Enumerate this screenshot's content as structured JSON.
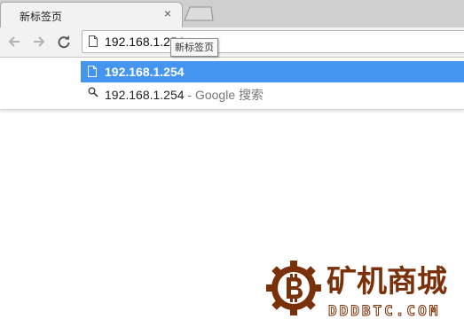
{
  "tab": {
    "title": "新标签页",
    "close_icon": "close-icon"
  },
  "toolbar": {
    "back_icon": "arrow-left-icon",
    "forward_icon": "arrow-right-icon",
    "reload_icon": "reload-icon"
  },
  "omnibox": {
    "value": "192.168.1.254",
    "page_icon": "page-icon",
    "tooltip": "新标签页"
  },
  "suggestions": [
    {
      "icon": "page-icon",
      "text": "192.168.1.254",
      "description": "",
      "selected": true
    },
    {
      "icon": "search-icon",
      "text": "192.168.1.254",
      "description": " - Google 搜索",
      "selected": false
    }
  ],
  "watermark": {
    "title": "矿机商城",
    "subtitle": "DDDBTC.COM",
    "logo_icon": "bitcoin-logo-icon",
    "color": "#7a3008"
  },
  "colors": {
    "selection": "#4495ef",
    "tabstrip": "#cfcfcf",
    "toolbar": "#f2f2f2"
  }
}
